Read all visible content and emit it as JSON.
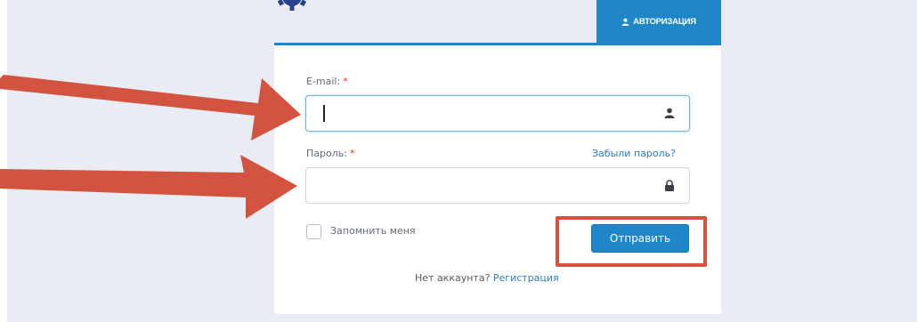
{
  "header": {
    "tab_label": "АВТОРИЗАЦИЯ",
    "tab_icon": "user-icon",
    "accent_color": "#1f86c8"
  },
  "form": {
    "email": {
      "label": "E-mail:",
      "required_mark": "*",
      "value": "",
      "icon": "user-icon"
    },
    "password": {
      "label": "Пароль:",
      "required_mark": "*",
      "value": "",
      "icon": "lock-icon",
      "forgot_link": "Забыли пароль?"
    },
    "remember": {
      "label": "Запомнить меня",
      "checked": false
    },
    "submit_label": "Отправить",
    "register_prompt": "Нет аккаунта?",
    "register_link": "Регистрация"
  },
  "annotations": {
    "arrow_color": "#d2533f",
    "highlight_color": "#d2533f"
  }
}
